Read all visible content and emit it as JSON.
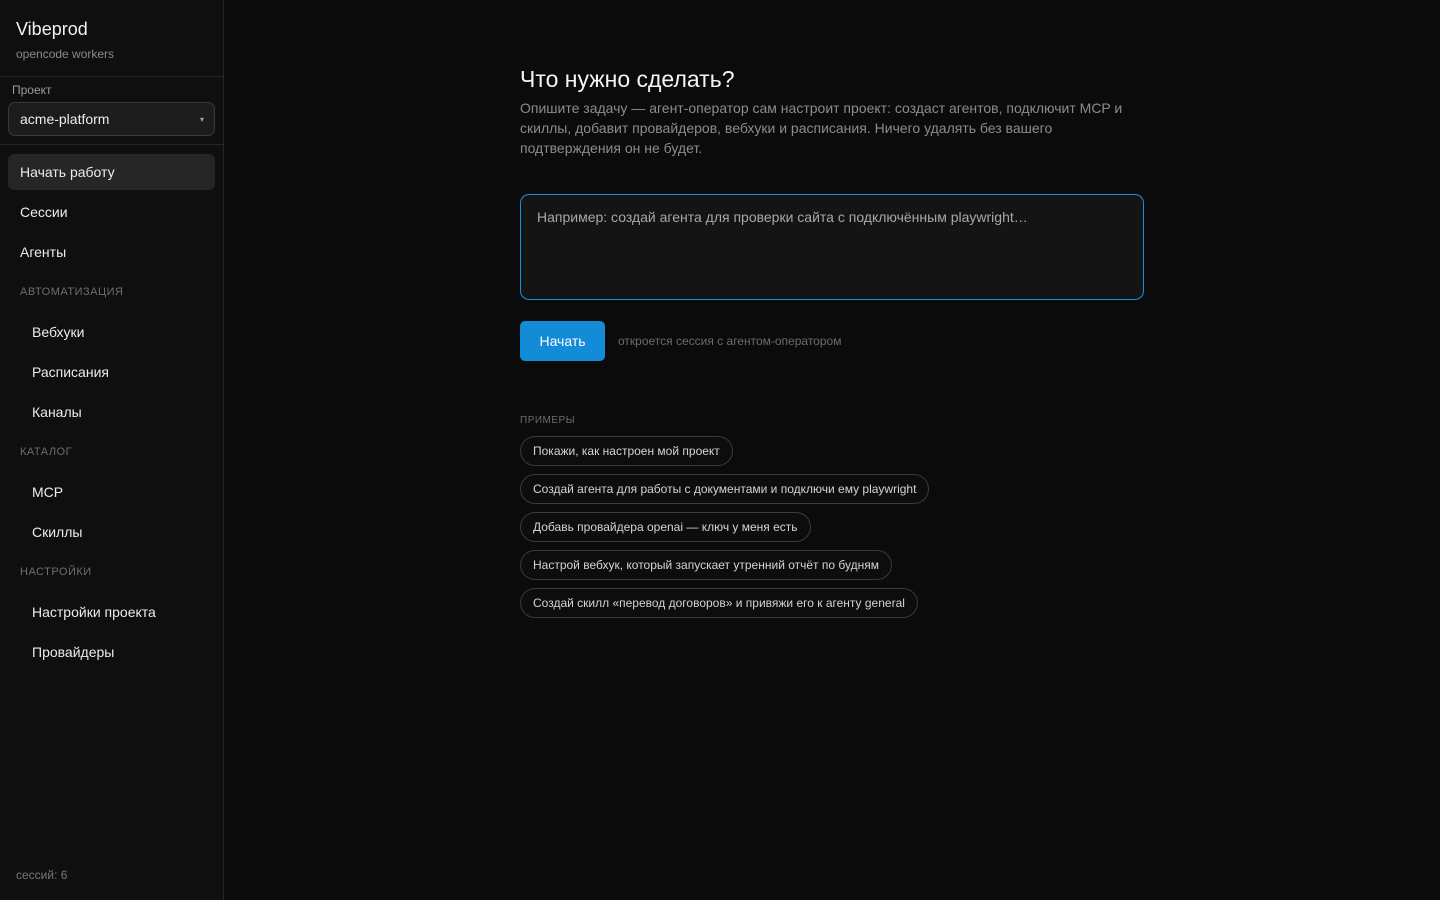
{
  "brand": {
    "title": "Vibeprod",
    "subtitle": "opencode workers"
  },
  "project": {
    "label": "Проект",
    "selected": "acme-platform",
    "caret_icon": "▾"
  },
  "nav": {
    "main": [
      {
        "label": "Начать работу",
        "active": true
      },
      {
        "label": "Сессии"
      },
      {
        "label": "Агенты"
      }
    ],
    "automation": {
      "title": "Автоматизация",
      "items": [
        {
          "label": "Вебхуки"
        },
        {
          "label": "Расписания"
        },
        {
          "label": "Каналы"
        }
      ]
    },
    "catalog": {
      "title": "Каталог",
      "items": [
        {
          "label": "MCP"
        },
        {
          "label": "Скиллы"
        }
      ]
    },
    "settings": {
      "title": "Настройки",
      "items": [
        {
          "label": "Настройки проекта"
        },
        {
          "label": "Провайдеры"
        }
      ]
    }
  },
  "sessions_count": "сессий: 6",
  "main": {
    "heading": "Что нужно сделать?",
    "description": "Опишите задачу — агент-оператор сам настроит проект: создаст агентов, подключит MCP и скиллы, добавит провайдеров, вебхуки и расписания. Ничего удалять без вашего подтверждения он не будет.",
    "task_placeholder": "Например: создай агента для проверки сайта с подключённым playwright…",
    "start_button": "Начать",
    "hint": "откроется сессия с агентом-оператором",
    "examples_label": "Примеры",
    "examples": [
      "Покажи, как настроен мой проект",
      "Создай агента для работы с документами и подключи ему playwright",
      "Добавь провайдера openai — ключ у меня есть",
      "Настрой вебхук, который запускает утренний отчёт по будням",
      "Создай скилл «перевод договоров» и привяжи его к агенту general"
    ]
  },
  "colors": {
    "accent": "#138bd6",
    "focus_border": "#1a8fd9",
    "background": "#0b0b0b",
    "sidebar": "#0f0f0f"
  }
}
